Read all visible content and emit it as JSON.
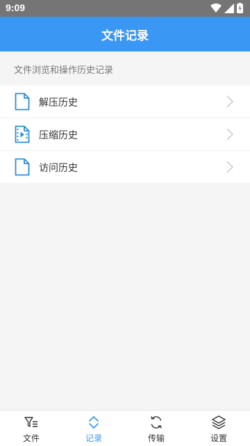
{
  "status_bar": {
    "time": "9:09"
  },
  "app_bar": {
    "title": "文件记录"
  },
  "section": {
    "header": "文件浏览和操作历史记录"
  },
  "list": {
    "items": [
      {
        "label": "解压历史",
        "icon": "file-icon"
      },
      {
        "label": "压缩历史",
        "icon": "video-file-icon"
      },
      {
        "label": "访问历史",
        "icon": "file-icon"
      }
    ]
  },
  "bottom_nav": {
    "items": [
      {
        "label": "文件",
        "icon": "filter-list-icon",
        "active": false
      },
      {
        "label": "记录",
        "icon": "expand-collapse-icon",
        "active": true
      },
      {
        "label": "传输",
        "icon": "sync-icon",
        "active": false
      },
      {
        "label": "设置",
        "icon": "layers-icon",
        "active": false
      }
    ]
  },
  "colors": {
    "primary": "#3b97f4",
    "status_bar": "#757575",
    "icon_blue": "#2a8fd6"
  }
}
